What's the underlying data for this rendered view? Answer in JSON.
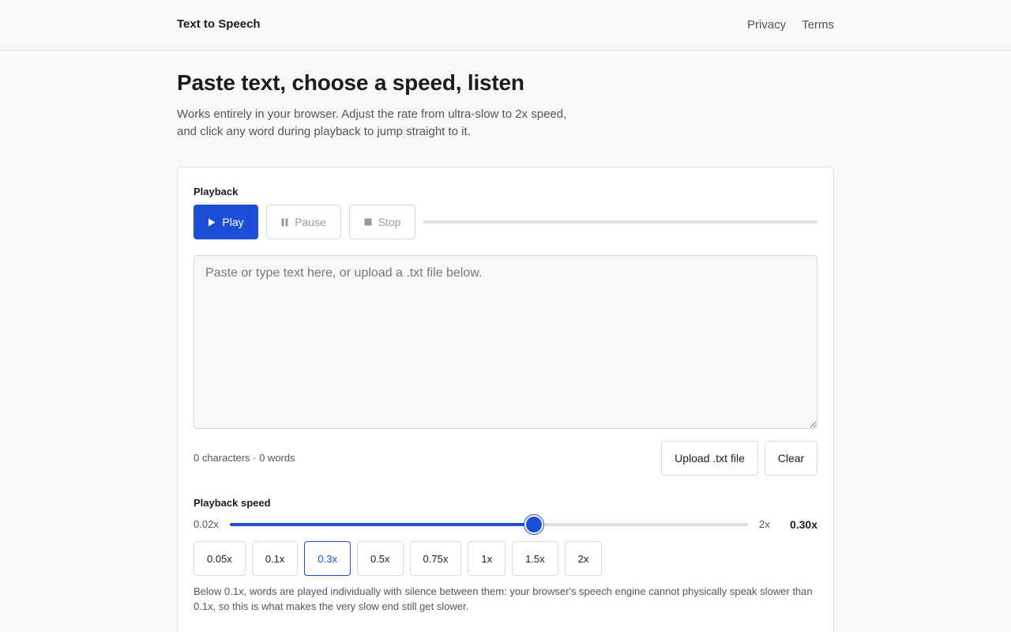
{
  "header": {
    "brand": "Text to Speech",
    "nav": [
      {
        "label": "Privacy"
      },
      {
        "label": "Terms"
      }
    ]
  },
  "hero": {
    "title": "Paste text, choose a speed, listen",
    "subtitle_line1": "Works entirely in your browser. Adjust the rate from ultra-slow to 2x speed,",
    "subtitle_line2": "and click any word during playback to jump straight to it."
  },
  "playback": {
    "label": "Playback",
    "play_label": "Play",
    "pause_label": "Pause",
    "stop_label": "Stop",
    "progress": 0
  },
  "editor": {
    "value": "",
    "placeholder": "Paste or type text here, or upload a .txt file below.",
    "counts": "0 characters · 0 words",
    "upload_label": "Upload .txt file",
    "clear_label": "Clear"
  },
  "speed": {
    "label": "Playback speed",
    "min_label": "0.02x",
    "max_label": "2x",
    "value_label": "0.30x",
    "slider_fraction": 0.587,
    "presets": [
      "0.05x",
      "0.1x",
      "0.3x",
      "0.5x",
      "0.75x",
      "1x",
      "1.5x",
      "2x"
    ],
    "active_preset_index": 2,
    "note": "Below 0.1x, words are played individually with silence between them: your browser's speech engine cannot physically speak slower than 0.1x, so this is what makes the very slow end still get slower."
  },
  "colors": {
    "accent": "#1d4ed8",
    "background": "#f9f8f6"
  },
  "icons": {
    "play": "play-icon",
    "pause": "pause-icon",
    "stop": "stop-icon"
  }
}
